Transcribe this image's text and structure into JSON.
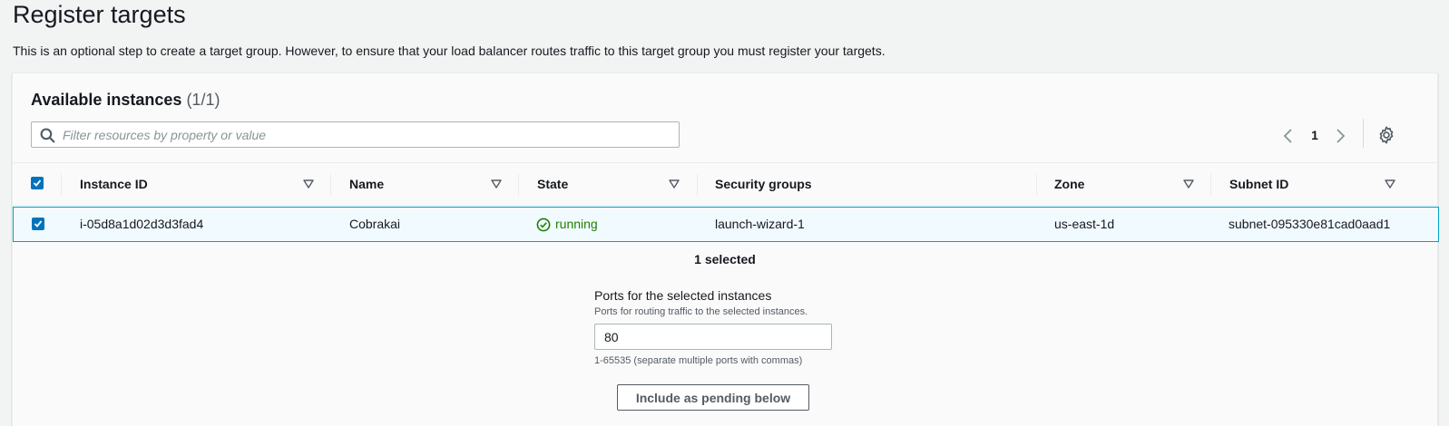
{
  "page": {
    "title": "Register targets",
    "description": "This is an optional step to create a target group. However, to ensure that your load balancer routes traffic to this target group you must register your targets."
  },
  "panel": {
    "title": "Available instances",
    "count": "(1/1)",
    "filter_placeholder": "Filter resources by property or value",
    "filter_value": "",
    "current_page": "1"
  },
  "table": {
    "columns": [
      "Instance ID",
      "Name",
      "State",
      "Security groups",
      "Zone",
      "Subnet ID"
    ],
    "rows": [
      {
        "selected": true,
        "instance_id": "i-05d8a1d02d3d3fad4",
        "name": "Cobrakai",
        "state": "running",
        "security_groups": "launch-wizard-1",
        "zone": "us-east-1d",
        "subnet_id": "subnet-095330e81cad0aad1"
      }
    ]
  },
  "selection": {
    "summary": "1 selected",
    "ports_label": "Ports for the selected instances",
    "ports_description": "Ports for routing traffic to the selected instances.",
    "ports_value": "80",
    "ports_hint": "1-65535 (separate multiple ports with commas)",
    "include_button": "Include as pending below"
  },
  "colors": {
    "accent": "#0073bb",
    "running": "#1d8102",
    "selected_row_bg": "#f1faff",
    "selected_row_border": "#00a1c9"
  },
  "icons": [
    "search-icon",
    "chevron-left-icon",
    "chevron-right-icon",
    "gear-icon",
    "sort-down-icon",
    "check-circle-icon",
    "checkbox-checked-icon"
  ]
}
